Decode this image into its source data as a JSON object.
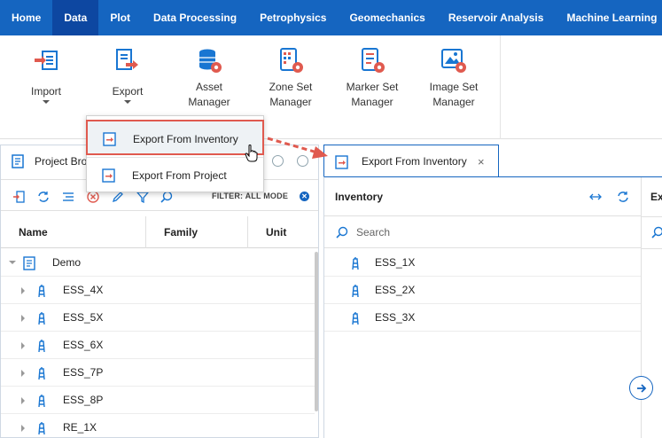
{
  "nav": {
    "items": [
      {
        "label": "Home",
        "active": false
      },
      {
        "label": "Data",
        "active": true
      },
      {
        "label": "Plot",
        "active": false
      },
      {
        "label": "Data Processing",
        "active": false
      },
      {
        "label": "Petrophysics",
        "active": false
      },
      {
        "label": "Geomechanics",
        "active": false
      },
      {
        "label": "Reservoir Analysis",
        "active": false
      },
      {
        "label": "Machine Learning",
        "active": false
      }
    ]
  },
  "ribbon": {
    "import_label": "Import",
    "export_label": "Export",
    "asset_manager_label": "Asset\nManager",
    "zone_set_manager_label": "Zone Set\nManager",
    "marker_set_manager_label": "Marker Set\nManager",
    "image_set_manager_label": "Image Set\nManager"
  },
  "dropdown": {
    "export_from_inventory": "Export From Inventory",
    "export_from_project": "Export From Project"
  },
  "project_browser": {
    "title": "Project Bro",
    "filter_label": "FILTER: ALL MODE",
    "columns": {
      "name": "Name",
      "family": "Family",
      "unit": "Unit"
    },
    "root": "Demo",
    "wells": [
      "ESS_4X",
      "ESS_5X",
      "ESS_6X",
      "ESS_7P",
      "ESS_8P",
      "RE_1X"
    ]
  },
  "export_tab": {
    "title": "Export From Inventory",
    "close": "×",
    "inventory_title": "Inventory",
    "search_placeholder": "Search",
    "items": [
      "ESS_1X",
      "ESS_2X",
      "ESS_3X"
    ],
    "second_column_label": "Ex"
  },
  "colors": {
    "nav_bg": "#1565c0",
    "nav_active": "#0d47a1",
    "accent_red": "#e05a4f",
    "icon_blue": "#1976d2"
  }
}
